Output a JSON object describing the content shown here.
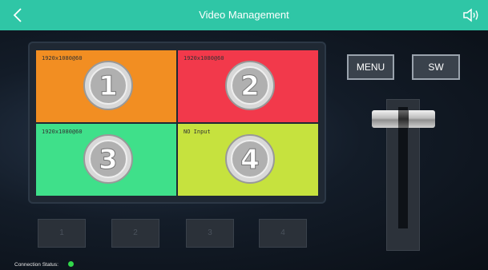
{
  "header": {
    "title": "Video Management",
    "back_icon": "chevron-left-icon",
    "sound_icon": "speaker-icon"
  },
  "tiles": [
    {
      "label": "1920x1080@60",
      "number": "1",
      "color": "#f28e22"
    },
    {
      "label": "1920x1080@60",
      "number": "2",
      "color": "#f2394b"
    },
    {
      "label": "1920x1080@60",
      "number": "3",
      "color": "#3fe08a"
    },
    {
      "label": "NO Input",
      "number": "4",
      "color": "#c6e23e"
    }
  ],
  "presets": [
    "1",
    "2",
    "3",
    "4"
  ],
  "controls": {
    "menu_label": "MENU",
    "sw_label": "SW"
  },
  "status": {
    "label": "Connection Status:",
    "color": "#31d84a"
  },
  "accent": "#2fc6a6"
}
